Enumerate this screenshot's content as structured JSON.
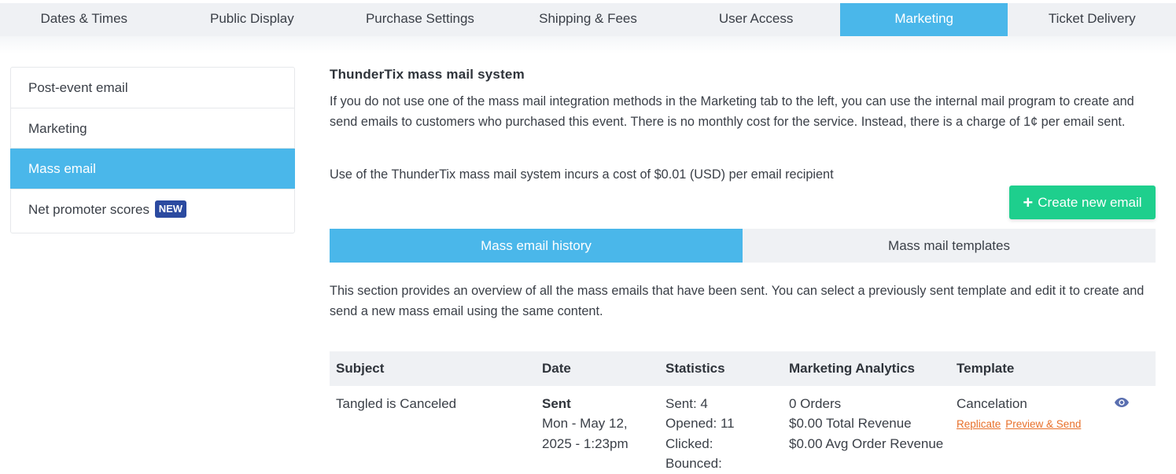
{
  "top_tabs": [
    {
      "label": "Dates & Times"
    },
    {
      "label": "Public Display"
    },
    {
      "label": "Purchase Settings"
    },
    {
      "label": "Shipping & Fees"
    },
    {
      "label": "User Access"
    },
    {
      "label": "Marketing",
      "active": true
    },
    {
      "label": "Ticket Delivery"
    }
  ],
  "side_nav": {
    "items": [
      {
        "label": "Post-event email"
      },
      {
        "label": "Marketing"
      },
      {
        "label": "Mass email",
        "active": true
      },
      {
        "label": "Net promoter scores",
        "badge": "NEW"
      }
    ]
  },
  "main": {
    "title": "ThunderTix mass mail system",
    "intro": "If you do not use one of the mass mail integration methods in the Marketing tab to the left, you can use the internal mail program to create and send emails to customers who purchased this event. There is no monthly cost for the service. Instead, there is a charge of 1¢ per email sent.",
    "cost_note": "Use of the ThunderTix mass mail system incurs a cost of $0.01 (USD) per email recipient",
    "create_button": "Create new email",
    "sub_tabs": [
      {
        "label": "Mass email history",
        "active": true
      },
      {
        "label": "Mass mail templates"
      }
    ],
    "history_description": "This section provides an overview of all the mass emails that have been sent. You can select a previously sent template and edit it to create and send a new mass email using the same content."
  },
  "table": {
    "headers": [
      "Subject",
      "Date",
      "Statistics",
      "Marketing Analytics",
      "Template"
    ],
    "rows": [
      {
        "subject": "Tangled is Canceled",
        "status": "Sent",
        "date_line1": "Mon - May 12,",
        "date_line2": "2025 - 1:23pm",
        "stat_sent": "Sent: 4",
        "stat_opened": "Opened: 11",
        "stat_clicked": "Clicked:",
        "stat_bounced": "Bounced:",
        "orders": "0 Orders",
        "total_revenue": "$0.00 Total Revenue",
        "avg_revenue": "$0.00 Avg Order Revenue",
        "template": "Cancelation",
        "replicate": "Replicate",
        "preview_send": "Preview & Send"
      }
    ]
  },
  "icons": {
    "eye": "eye-icon",
    "plus": "plus-icon"
  },
  "colors": {
    "accent": "#4ab7ea",
    "success": "#1ecf8d",
    "badge": "#2b4aa0",
    "link": "#e8702a"
  }
}
